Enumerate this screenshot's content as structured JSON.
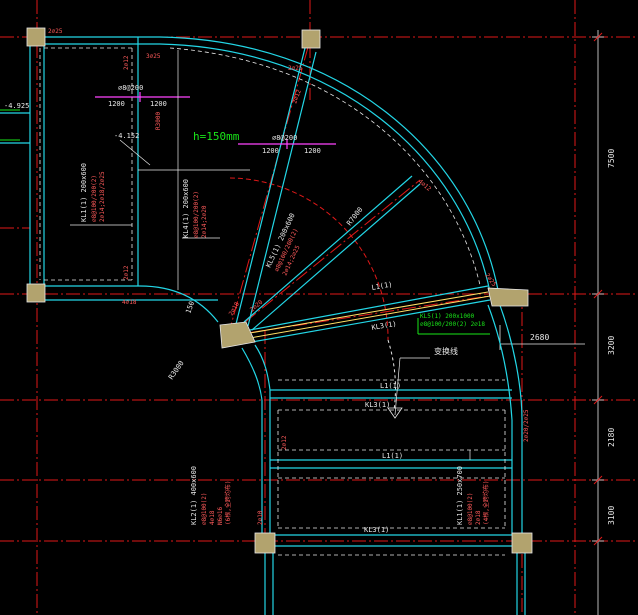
{
  "labels": {
    "slab_thickness": "h=150mm",
    "transform_line": "变换线",
    "elev_left": "-4.925",
    "elev_mid": "-4.152",
    "radius_outer": "R7000",
    "radius_inner": "R3000",
    "span_a": "1200",
    "span_b": "1200",
    "span_c": "1200",
    "span_d": "1200",
    "bar_top": "2⌀25",
    "bar_mid": "2⌀25",
    "bar_right": "2⌀25",
    "bar_a": "2⌀12",
    "bar_b": "2⌀12",
    "bar_c": "4⌀18",
    "bar_d": "2⌀12",
    "bar_e": "3⌀25",
    "bar_f": "4⌀12",
    "bar_g": "2⌀18",
    "bar_h": "2⌀20",
    "bar_i": "2⌀12",
    "bar_j": "2⌀20/2⌀25",
    "bar_k": "2⌀10",
    "dim_r": "R3000",
    "l1_a": "L1(1)",
    "l1_b": "L1(1)",
    "l1_c": "L1(1)",
    "kl3_a": "KL3(1)",
    "kl3_b": "KL3(1)",
    "kl3_c": "KL3(1)",
    "stir_a": "⌀8@200",
    "stir_b": "⌀8@200",
    "kl1_note": "KL1(1) 200x600",
    "kl1_sub1": "⌀8@100/200(2)",
    "kl1_sub2": "2⌀14;2⌀18/2⌀25",
    "kl4_note": "KL4(1) 200x600",
    "kl4_sub1": "⌀8@100/200(2)",
    "kl4_sub2": "2⌀14;2⌀20",
    "kl5_note": "KL5(1) 200x600",
    "kl5_sub1": "⌀8@100/200(2)",
    "kl5_sub2": "2⌀14;2⌀25",
    "kl2_note": "KL2(1) 400x600",
    "kl2_sub1": "⌀8@100(2)",
    "kl2_sub2": "4⌀18",
    "kl2_sub3": "N6⌀16",
    "kl2_sub4": "(6根,全跨均布)",
    "kl6_note": "KL1(1) 250x700",
    "kl6_sub1": "⌀8@100(2)",
    "kl6_sub2": "2⌀18",
    "kl6_sub3": "(4根,全跨均布)",
    "green_note1": "KL5(1) 200x1000",
    "green_note2": "⌀8@100/200(2) 2⌀18",
    "dim_7500": "7500",
    "dim_3200": "3200",
    "dim_2180": "2180",
    "dim_3100": "3100",
    "dim_2680": "2680",
    "dim_150": "150"
  }
}
